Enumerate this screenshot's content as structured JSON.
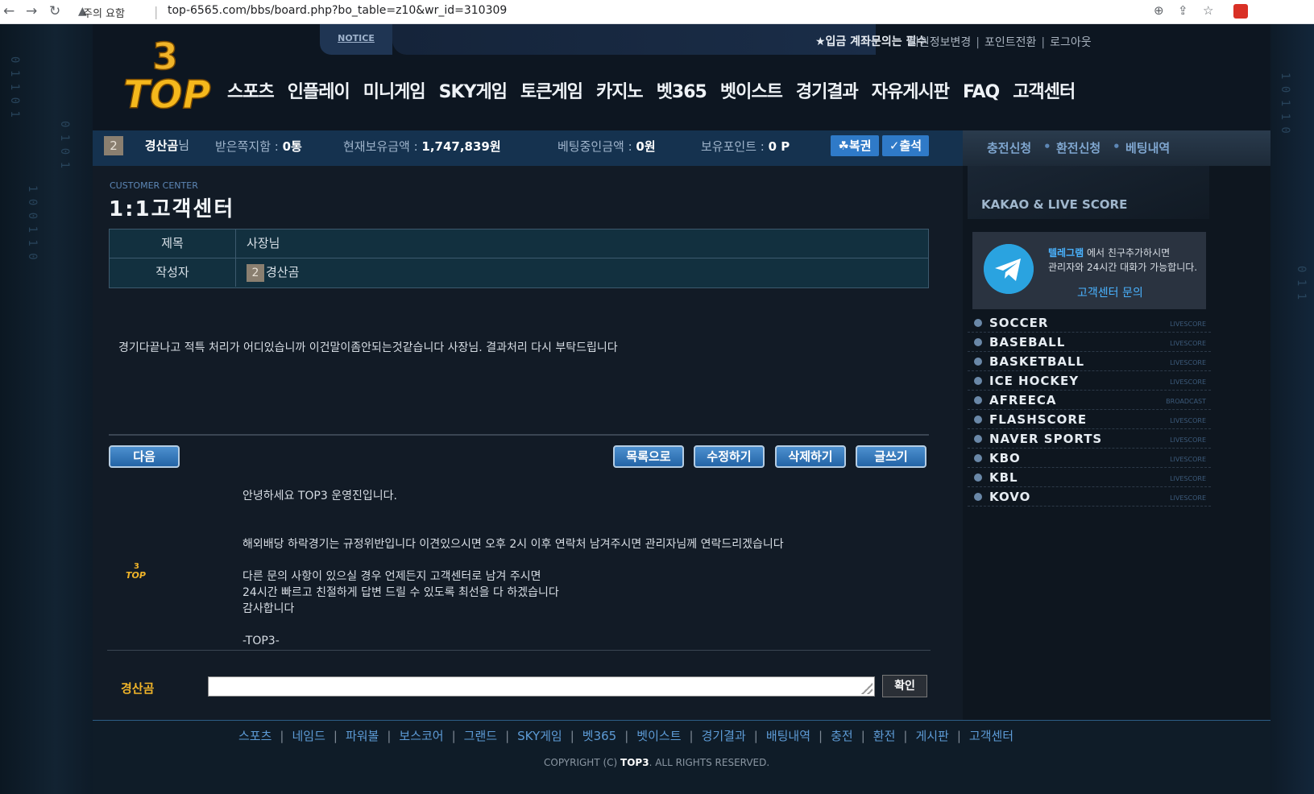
{
  "browser": {
    "warning": "주의 요함",
    "url": "top-6565.com/bbs/board.php?bo_table=z10&wr_id=310309"
  },
  "header": {
    "notice_tab": "NOTICE",
    "notice_text": "★입금 계좌문의는 필수",
    "util_links": [
      "회원정보변경",
      "포인트전환",
      "로그아웃"
    ],
    "nav": [
      "스포츠",
      "인플레이",
      "미니게임",
      "SKY게임",
      "토큰게임",
      "카지노",
      "벳365",
      "벳이스트",
      "경기결과",
      "자유게시판",
      "FAQ",
      "고객센터"
    ]
  },
  "status": {
    "level": "2",
    "username": "경산곰",
    "username_suffix": "님",
    "msg_label": "받은쪽지함 : ",
    "msg_value": "0통",
    "balance_label": "현재보유금액 : ",
    "balance_value": "1,747,839원",
    "bet_label": "베팅중인금액 : ",
    "bet_value": "0원",
    "point_label": "보유포인트 : ",
    "point_value": "0 P",
    "lotto_btn": "복권",
    "attend_btn": "출석",
    "right_links": [
      "충전신청",
      "환전신청",
      "베팅내역"
    ]
  },
  "content": {
    "section_sub": "CUSTOMER CENTER",
    "section_title": "1:1고객센터",
    "subject_label": "제목",
    "subject_value": "사장님",
    "author_label": "작성자",
    "author_level": "2",
    "author_name": "경산곰",
    "body": "경기다끝나고 적특 처리가 어디있습니까 이건말이좀안되는것같습니다 사장님. 결과처리 다시 부탁드립니다",
    "buttons": {
      "next": "다음",
      "list": "목록으로",
      "edit": "수정하기",
      "delete": "삭제하기",
      "write": "글쓰기"
    },
    "reply": {
      "line1": "안녕하세요 TOP3 운영진입니다.",
      "line2": "해외배당 하락경기는 규정위반입니다 이견있으시면 오후 2시 이후 연락처 남겨주시면 관리자님께 연락드리겠습니다",
      "line3": "다른 문의 사항이 있으실 경우 언제든지 고객센터로 남겨 주시면",
      "line4": "24시간 빠르고 친절하게 답변 드릴 수 있도록 최선을 다 하겠습니다",
      "line5": "감사합니다",
      "line6": "-TOP3-"
    },
    "comment_name": "경산곰",
    "comment_value": "",
    "confirm": "확인"
  },
  "sidebar": {
    "title": "KAKAO & LIVE SCORE",
    "tg_brand": "텔레그램",
    "tg_line1_rest": " 에서 친구추가하시면",
    "tg_line2": "관리자와 24시간 대화가 가능합니다.",
    "tg_link": "고객센터 문의",
    "scores": [
      {
        "name": "SOCCER",
        "tag": "LIVESCORE"
      },
      {
        "name": "BASEBALL",
        "tag": "LIVESCORE"
      },
      {
        "name": "BASKETBALL",
        "tag": "LIVESCORE"
      },
      {
        "name": "ICE HOCKEY",
        "tag": "LIVESCORE"
      },
      {
        "name": "AFREECA",
        "tag": "BROADCAST"
      },
      {
        "name": "FLASHSCORE",
        "tag": "LIVESCORE"
      },
      {
        "name": "NAVER SPORTS",
        "tag": "LIVESCORE"
      },
      {
        "name": "KBO",
        "tag": "LIVESCORE"
      },
      {
        "name": "KBL",
        "tag": "LIVESCORE"
      },
      {
        "name": "KOVO",
        "tag": "LIVESCORE"
      }
    ]
  },
  "footer": {
    "nav": [
      "스포츠",
      "네임드",
      "파워볼",
      "보스코어",
      "그랜드",
      "SKY게임",
      "벳365",
      "벳이스트",
      "경기결과",
      "배팅내역",
      "충전",
      "환전",
      "게시판",
      "고객센터"
    ],
    "copy_pre": "COPYRIGHT (C) ",
    "copy_brand": "TOP3",
    "copy_post": ". ALL RIGHTS RESERVED."
  },
  "colors": {
    "accent": "#2f7ac8",
    "gold": "#f0b429",
    "link": "#4ab3ff"
  }
}
